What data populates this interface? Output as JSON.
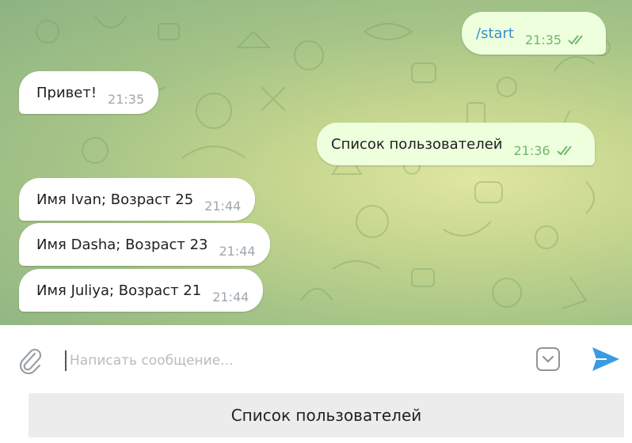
{
  "messages": [
    {
      "direction": "out",
      "text": "/start",
      "time": "21:35",
      "read": true
    },
    {
      "direction": "in",
      "text": "Привет!",
      "time": "21:35"
    },
    {
      "direction": "out",
      "text": "Список пользователей",
      "time": "21:36",
      "read": true
    },
    {
      "direction": "in",
      "text": "Имя Ivan; Возраст 25",
      "time": "21:44"
    },
    {
      "direction": "in",
      "text": "Имя Dasha; Возраст 23",
      "time": "21:44"
    },
    {
      "direction": "in",
      "text": "Имя Juliya; Возраст 21",
      "time": "21:44"
    }
  ],
  "input": {
    "placeholder": "Написать сообщение...",
    "value": ""
  },
  "icons": {
    "attach": "paperclip-icon",
    "keyboard": "keyboard-toggle-icon",
    "send": "send-icon",
    "read": "double-check-icon"
  },
  "reply_keyboard": {
    "buttons": [
      "Список пользователей"
    ]
  },
  "colors": {
    "accent": "#3a8fd0",
    "outgoing_bubble": "#eeffde",
    "incoming_bubble": "#ffffff",
    "read_check": "#6fb86a"
  }
}
